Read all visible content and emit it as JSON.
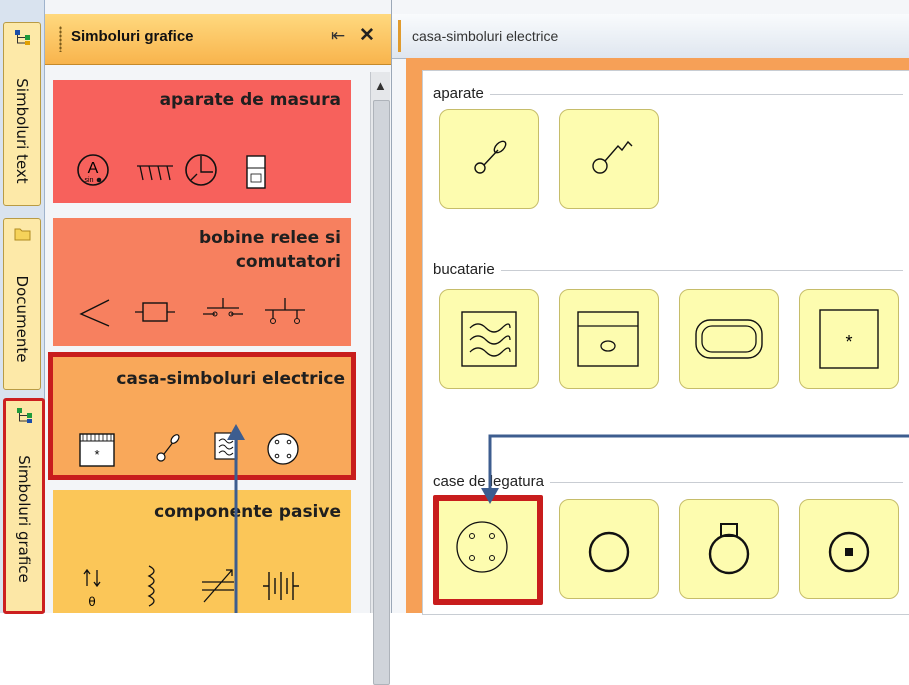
{
  "side_tabs": [
    {
      "label": "Simboluri text",
      "icon": "tree-diagram-icon"
    },
    {
      "label": "Documente",
      "icon": "folder-icon"
    },
    {
      "label": "Simboluri grafice",
      "icon": "tree-diagram-icon"
    }
  ],
  "panel": {
    "title": "Simboluri grafice",
    "pin_icon": "pin-icon",
    "close_icon": "close-icon",
    "categories": [
      {
        "title": "aparate de masura",
        "color": "#f7615c",
        "symbols": [
          "ammeter-symbol",
          "meter-array-symbol",
          "wattmeter-symbol",
          "counter-symbol"
        ],
        "meter_label_main": "A",
        "meter_label_sub": "sin"
      },
      {
        "title": "bobine relee si comutatori",
        "color": "#f7805f",
        "symbols": [
          "switch-symbol",
          "relay-coil-symbol",
          "pushbutton-symbol",
          "contact-symbol"
        ]
      },
      {
        "title": "casa-simboluri electrice",
        "color": "#f9a85a",
        "symbols": [
          "panel-box-symbol",
          "key-switch-symbol",
          "heater-symbol",
          "junction-box-symbol"
        ],
        "panel_mark": "*"
      },
      {
        "title": "componente pasive",
        "color": "#fbc658",
        "symbols": [
          "thermistor-symbol",
          "inductor-symbol",
          "variable-capacitor-symbol",
          "battery-symbol"
        ],
        "thermistor_mark": "θ"
      }
    ]
  },
  "document": {
    "tab_label": "casa-simboluri electrice",
    "groups": [
      {
        "label": "aparate",
        "tiles": [
          "switch-key-tile",
          "switch-zigzag-tile"
        ]
      },
      {
        "label": "bucatarie",
        "tiles": [
          "cooker-hood-tile",
          "oven-tile",
          "sink-tile",
          "appliance-star-tile"
        ],
        "appliance_mark": "*"
      },
      {
        "label": "case de legatura",
        "tiles": [
          "junction-box-4-tile",
          "circle-tile",
          "circle-tab-tile",
          "circle-dot-tile"
        ]
      }
    ]
  },
  "colors": {
    "highlight": "#c81d1d",
    "arrow": "#3d5d8f",
    "tile": "#fdfcaf",
    "frame": "#f6a057"
  }
}
